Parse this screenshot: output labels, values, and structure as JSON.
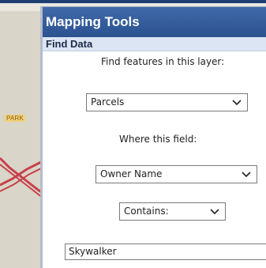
{
  "map": {
    "label": "PARK"
  },
  "panel": {
    "title": "Mapping Tools",
    "section_title": "Find Data",
    "layer_prompt": "Find features in this layer:",
    "layer_select": {
      "value": "Parcels"
    },
    "field_prompt": "Where this field:",
    "field_select": {
      "value": "Owner Name"
    },
    "operator_select": {
      "value": "Contains:"
    },
    "search_input": {
      "value": "Skywalker"
    }
  },
  "colors": {
    "title_bar": "#2c5290",
    "section_bar": "#dce5f3",
    "map_road": "#c8404a",
    "map_label_bg": "#f2d27a"
  },
  "icons": {
    "dropdown": "chevron-down-icon"
  }
}
